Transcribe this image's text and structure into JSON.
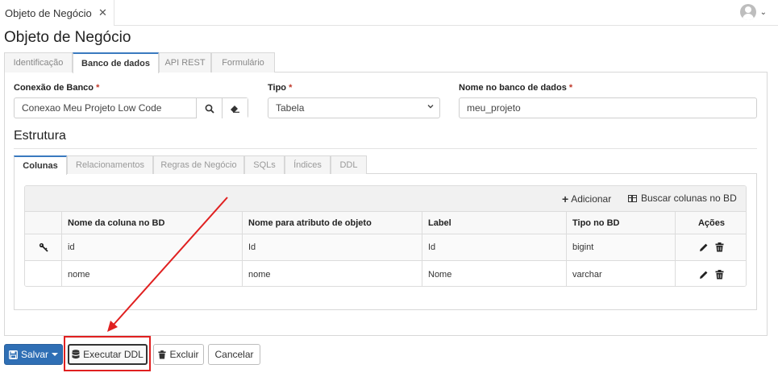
{
  "window": {
    "tab_title": "Objeto de Negócio",
    "tab_close": "✕"
  },
  "user_menu": {
    "chevron": "⌄"
  },
  "page": {
    "title": "Objeto de Negócio"
  },
  "main_tabs": [
    {
      "label": "Identificação",
      "active": false
    },
    {
      "label": "Banco de dados",
      "active": true
    },
    {
      "label": "API REST",
      "active": false
    },
    {
      "label": "Formulário",
      "active": false
    }
  ],
  "form": {
    "conexao": {
      "label": "Conexão de Banco",
      "required": "*",
      "value": "Conexao Meu Projeto Low Code"
    },
    "tipo": {
      "label": "Tipo",
      "required": "*",
      "value": "Tabela"
    },
    "nome_banco": {
      "label": "Nome no banco de dados",
      "required": "*",
      "value": "meu_projeto"
    }
  },
  "estrutura": {
    "title": "Estrutura",
    "tabs": [
      {
        "label": "Colunas",
        "active": true
      },
      {
        "label": "Relacionamentos",
        "active": false
      },
      {
        "label": "Regras de Negócio",
        "active": false
      },
      {
        "label": "SQLs",
        "active": false
      },
      {
        "label": "Índices",
        "active": false
      },
      {
        "label": "DDL",
        "active": false
      }
    ]
  },
  "grid": {
    "toolbar": {
      "add_icon": "+",
      "add_label": "Adicionar",
      "fetch_label": "Buscar colunas no BD"
    },
    "columns": [
      "Nome da coluna no BD",
      "Nome para atributo de objeto",
      "Label",
      "Tipo no BD",
      "Ações"
    ],
    "rows": [
      {
        "primary_key": true,
        "coluna": "id",
        "atributo": "Id",
        "label": "Id",
        "tipo": "bigint"
      },
      {
        "primary_key": false,
        "coluna": "nome",
        "atributo": "nome",
        "label": "Nome",
        "tipo": "varchar"
      }
    ]
  },
  "footer": {
    "save_label": "Salvar",
    "execute_ddl_label": "Executar DDL",
    "delete_label": "Excluir",
    "cancel_label": "Cancelar"
  },
  "colors": {
    "primary": "#2f6fb5",
    "required": "#c0392b",
    "annotation": "#e02020",
    "tab_accent": "#3a7abf"
  },
  "icons": [
    "search-icon",
    "eraser-icon",
    "chevron-down-icon",
    "key-icon",
    "pencil-icon",
    "trash-icon",
    "plus-icon",
    "table-icon",
    "save-icon",
    "database-icon"
  ]
}
